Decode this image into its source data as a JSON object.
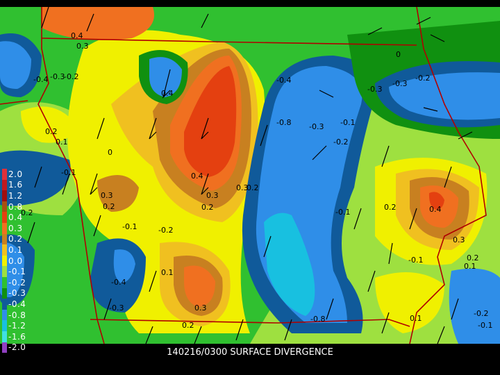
{
  "caption": "140216/0300 SURFACE DIVERGENCE",
  "legend": [
    {
      "label": "2.0",
      "color": "#e0303a"
    },
    {
      "label": "1.6",
      "color": "#c01820"
    },
    {
      "label": "1.2",
      "color": "#a00e10"
    },
    {
      "label": "0.8",
      "color": "#a85010"
    },
    {
      "label": "0.4",
      "color": "#e44010"
    },
    {
      "label": "0.3",
      "color": "#f07020"
    },
    {
      "label": "0.2",
      "color": "#c88020"
    },
    {
      "label": "0.1",
      "color": "#f0c020"
    },
    {
      "label": "0.0",
      "color": "#f0f000"
    },
    {
      "label": "-0.1",
      "color": "#9ee040"
    },
    {
      "label": "-0.2",
      "color": "#30c030"
    },
    {
      "label": "-0.3",
      "color": "#109010"
    },
    {
      "label": "-0.4",
      "color": "#105a9a"
    },
    {
      "label": "-0.8",
      "color": "#2f8ee8"
    },
    {
      "label": "-1.2",
      "color": "#18c0e0"
    },
    {
      "label": "-1.6",
      "color": "#40e0e0"
    },
    {
      "label": "-2.0",
      "color": "#9040c0"
    }
  ],
  "contour_labels": [
    "0.4",
    "0.3",
    "-0.4",
    "-0.3",
    "-0.2",
    "0.2",
    "0.1",
    "0",
    "-0.1",
    "-0.8",
    "0.2",
    "-0.3",
    "-0.2",
    "-0.1",
    "0.4",
    "0.3",
    "-0.1",
    "-0.2",
    "0.3",
    "0.2",
    "0.4",
    "0.3",
    "0.2",
    "0.1",
    "-0.3",
    "-0.4",
    "0.3",
    "0.2",
    "-0.8",
    "-0.3",
    "0.2",
    "-0.1",
    "-0.4",
    "-0.3",
    "-0.2",
    "0",
    "0.4",
    "0.3",
    "0.2",
    "0.1",
    "-0.2",
    "-0.1",
    "0.1",
    "-0.1",
    "0.2"
  ],
  "colors": {
    "border": "#b00000",
    "contour": "#000000"
  }
}
